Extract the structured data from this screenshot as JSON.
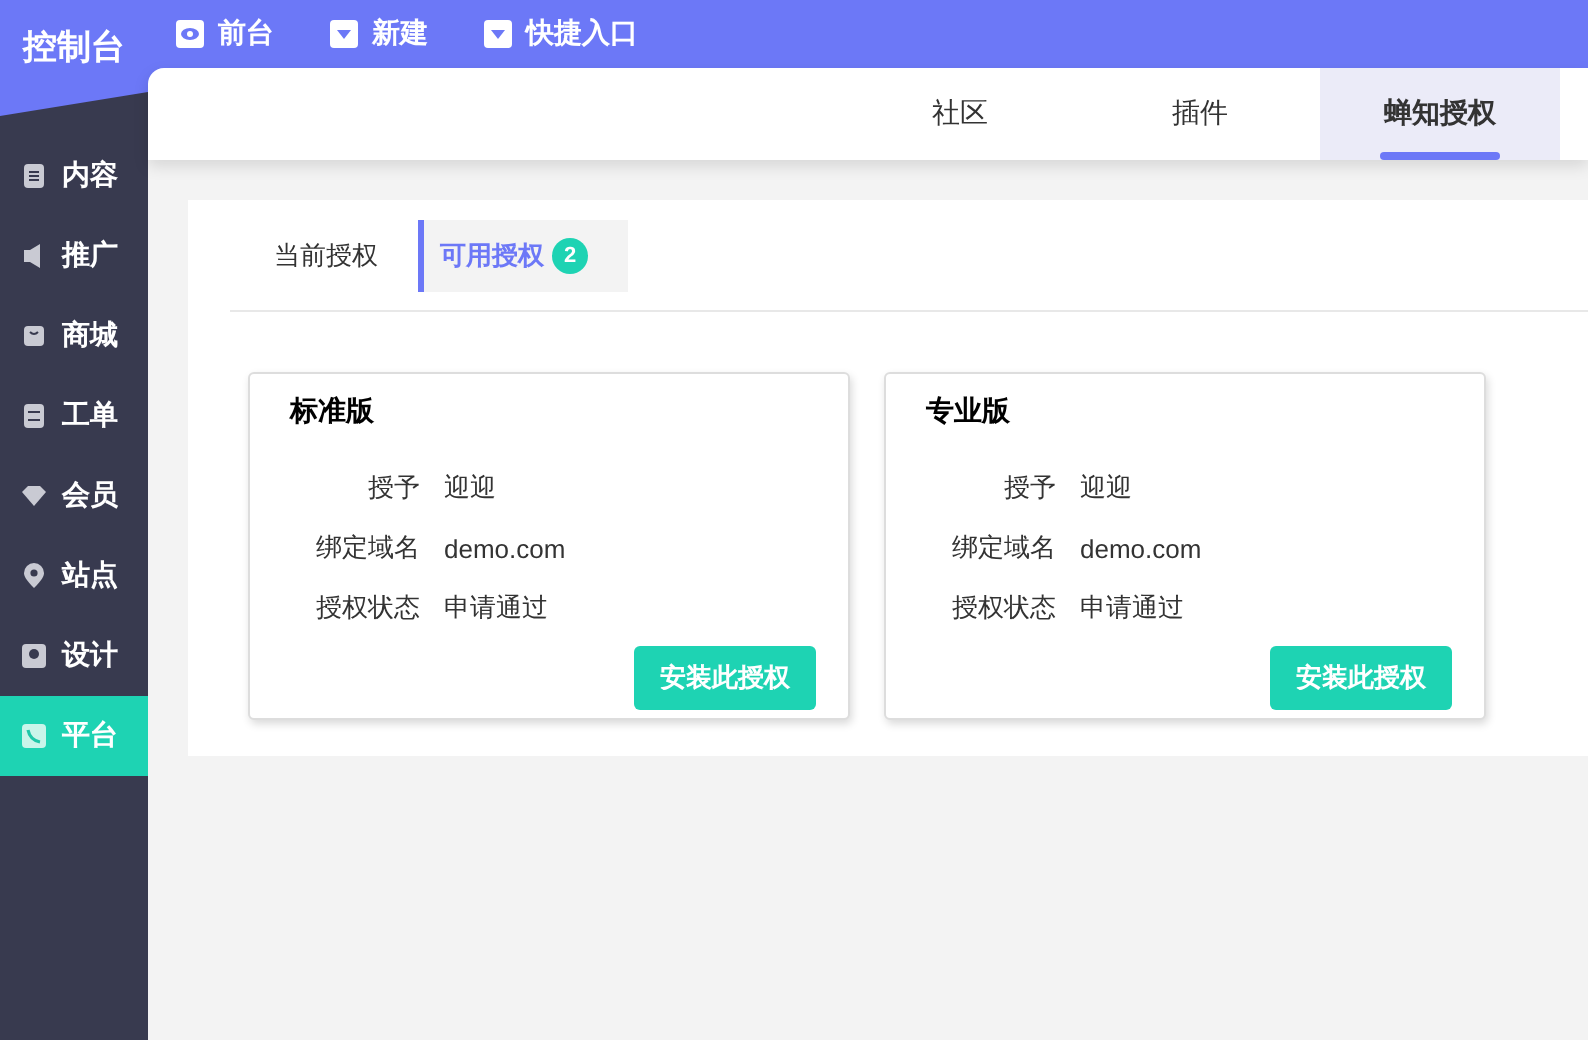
{
  "sidebar": {
    "title": "控制台",
    "items": [
      {
        "label": "内容",
        "selected": false
      },
      {
        "label": "推广",
        "selected": false
      },
      {
        "label": "商城",
        "selected": false
      },
      {
        "label": "工单",
        "selected": false
      },
      {
        "label": "会员",
        "selected": false
      },
      {
        "label": "站点",
        "selected": false
      },
      {
        "label": "设计",
        "selected": false
      },
      {
        "label": "平台",
        "selected": true
      }
    ]
  },
  "top_nav": [
    {
      "label": "前台",
      "kind": "eye"
    },
    {
      "label": "新建",
      "kind": "dropdown"
    },
    {
      "label": "快捷入口",
      "kind": "dropdown"
    }
  ],
  "tabs": [
    {
      "label": "社区",
      "selected": false
    },
    {
      "label": "插件",
      "selected": false
    },
    {
      "label": "蝉知授权",
      "selected": true
    }
  ],
  "sub_tabs": [
    {
      "label": "当前授权",
      "selected": false
    },
    {
      "label": "可用授权",
      "selected": true,
      "badge": "2"
    }
  ],
  "cards": [
    {
      "title": "标准版",
      "fields": [
        {
          "label": "授予",
          "value": "迎迎"
        },
        {
          "label": "绑定域名",
          "value": "demo.com"
        },
        {
          "label": "授权状态",
          "value": "申请通过"
        }
      ],
      "button": "安装此授权"
    },
    {
      "title": "专业版",
      "fields": [
        {
          "label": "授予",
          "value": "迎迎"
        },
        {
          "label": "绑定域名",
          "value": "demo.com"
        },
        {
          "label": "授权状态",
          "value": "申请通过"
        }
      ],
      "button": "安装此授权"
    }
  ]
}
